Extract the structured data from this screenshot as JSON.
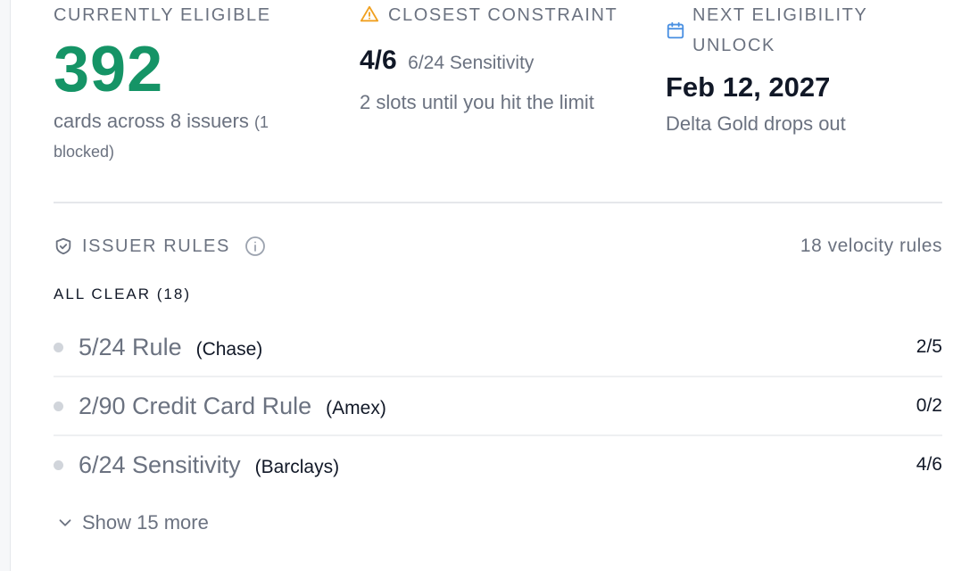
{
  "stats": {
    "eligible": {
      "label": "CURRENTLY ELIGIBLE",
      "value": "392",
      "description": "cards across 8 issuers",
      "blocked_note": "(1 blocked)"
    },
    "constraint": {
      "label": "CLOSEST CONSTRAINT",
      "fraction": "4/6",
      "rule_name": "6/24 Sensitivity",
      "description": "2 slots until you hit the limit",
      "icon": "warning-triangle-icon",
      "icon_color": "#f0a020"
    },
    "next_unlock": {
      "label": "NEXT ELIGIBILITY UNLOCK",
      "date": "Feb 12, 2027",
      "description": "Delta Gold drops out",
      "icon": "calendar-icon",
      "icon_color": "#4a90e2"
    }
  },
  "rules": {
    "title": "ISSUER RULES",
    "count_text": "18 velocity rules",
    "section_label": "ALL CLEAR (18)",
    "items": [
      {
        "name": "5/24 Rule",
        "issuer": "(Chase)",
        "value": "2/5"
      },
      {
        "name": "2/90 Credit Card Rule",
        "issuer": "(Amex)",
        "value": "0/2"
      },
      {
        "name": "6/24 Sensitivity",
        "issuer": "(Barclays)",
        "value": "4/6"
      }
    ],
    "show_more": "Show 15 more"
  },
  "colors": {
    "accent_green": "#159466",
    "muted_text": "#6b7280",
    "dark_text": "#111827"
  }
}
